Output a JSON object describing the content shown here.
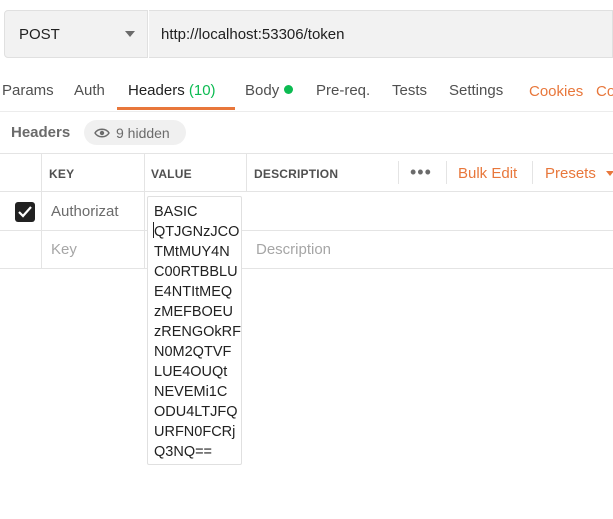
{
  "request": {
    "method": "POST",
    "url": "http://localhost:53306/token"
  },
  "tabs": {
    "params": "Params",
    "auth": "Auth",
    "headers": "Headers",
    "headers_count": "(10)",
    "body": "Body",
    "prereq": "Pre-req.",
    "tests": "Tests",
    "settings": "Settings",
    "cookies": "Cookies",
    "cookies_overflow": "Co"
  },
  "headers_section": {
    "title": "Headers",
    "hidden_label": "9 hidden"
  },
  "table": {
    "columns": {
      "key": "KEY",
      "value": "VALUE",
      "description": "DESCRIPTION"
    },
    "more": "•••",
    "bulk_edit": "Bulk Edit",
    "presets": "Presets",
    "rows": [
      {
        "checked": true,
        "key": "Authorizat",
        "value": "BASIC\nQTJGNzJCO\nTMtMUY4N\nC00RTBBLU\nE4NTItMEQ\nzMEFBOEU\nzRENGOkRF\nN0M2QTVF\nLUE4OUQt\nNEVEMi1C\nODU4LTJFQ\nURFN0FCRj\nQ3NQ=="
      }
    ],
    "new_row": {
      "key_placeholder": "Key",
      "description_placeholder": "Description"
    }
  },
  "colors": {
    "accent": "#e8773b",
    "success": "#0cbb52"
  }
}
